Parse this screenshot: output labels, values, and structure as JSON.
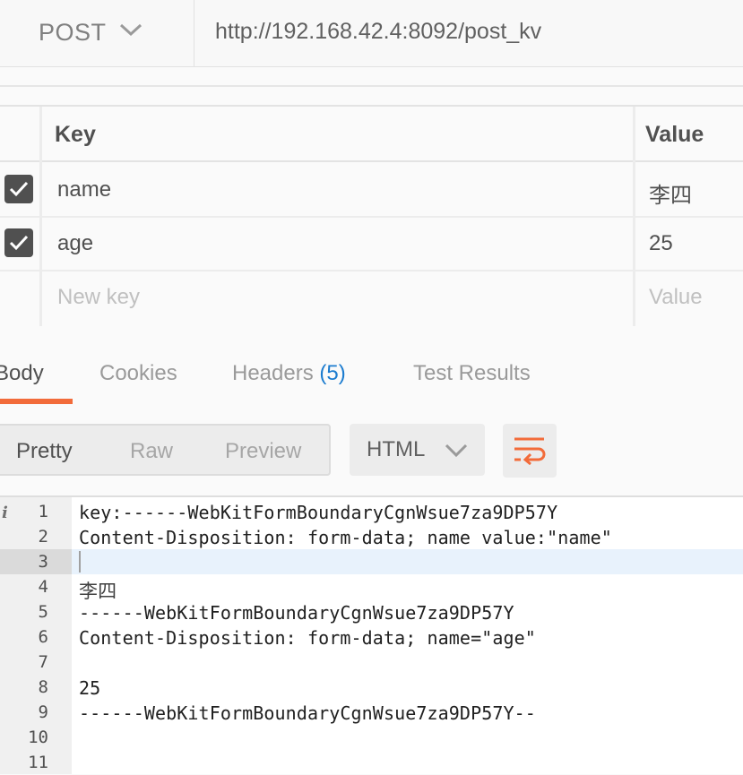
{
  "request": {
    "method": "POST",
    "url": "http://192.168.42.4:8092/post_kv"
  },
  "params": {
    "headers": {
      "key": "Key",
      "value": "Value"
    },
    "rows": [
      {
        "key": "name",
        "value": "李四",
        "checked": true
      },
      {
        "key": "age",
        "value": "25",
        "checked": true
      }
    ],
    "new_row": {
      "key_placeholder": "New key",
      "value_placeholder": "Value"
    }
  },
  "response": {
    "tabs": {
      "body": "Body",
      "cookies": "Cookies",
      "headers": "Headers",
      "headers_count": "(5)",
      "test_results": "Test Results"
    },
    "view_modes": {
      "pretty": "Pretty",
      "raw": "Raw",
      "preview": "Preview"
    },
    "format": "HTML",
    "lines": [
      {
        "n": "1",
        "text": "key:------WebKitFormBoundaryCgnWsue7za9DP57Y"
      },
      {
        "n": "2",
        "text": "Content-Disposition: form-data; name value:\"name\""
      },
      {
        "n": "3",
        "text": ""
      },
      {
        "n": "4",
        "text": "李四"
      },
      {
        "n": "5",
        "text": "------WebKitFormBoundaryCgnWsue7za9DP57Y"
      },
      {
        "n": "6",
        "text": "Content-Disposition: form-data; name=\"age\""
      },
      {
        "n": "7",
        "text": ""
      },
      {
        "n": "8",
        "text": "25"
      },
      {
        "n": "9",
        "text": "------WebKitFormBoundaryCgnWsue7za9DP57Y--"
      },
      {
        "n": "10",
        "text": ""
      },
      {
        "n": "11",
        "text": ""
      }
    ],
    "info_marker": "i"
  },
  "colors": {
    "accent": "#f26b3a",
    "link_blue": "#1c7ccf",
    "checkbox": "#505050"
  }
}
